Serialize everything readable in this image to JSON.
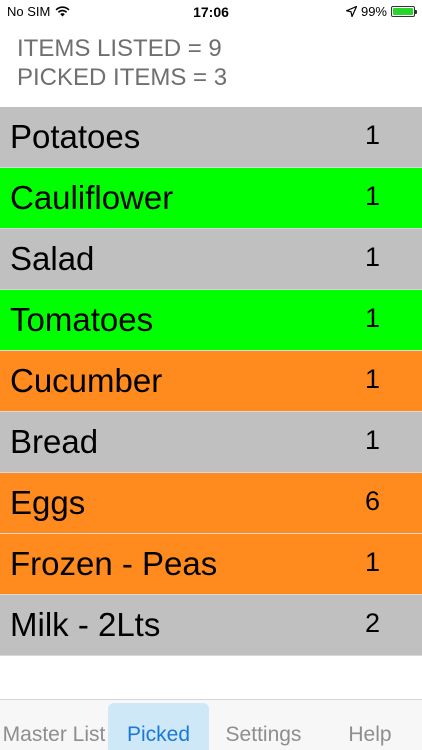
{
  "status_bar": {
    "carrier": "No SIM",
    "time": "17:06",
    "battery_percent": "99%",
    "battery_level": 0.99,
    "icons": [
      "wifi-icon",
      "location-arrow-icon",
      "battery-icon"
    ]
  },
  "summary": {
    "items_listed": "ITEMS LISTED = 9",
    "picked_items": "PICKED ITEMS = 3"
  },
  "colors": {
    "grey": "#c0c0c0",
    "green": "#00ff00",
    "orange": "#ff8a1e"
  },
  "items": [
    {
      "name": "Potatoes",
      "qty": "1",
      "color": "#c0c0c0"
    },
    {
      "name": "Cauliflower",
      "qty": "1",
      "color": "#00ff00"
    },
    {
      "name": "Salad",
      "qty": "1",
      "color": "#c0c0c0"
    },
    {
      "name": "Tomatoes",
      "qty": "1",
      "color": "#00ff00"
    },
    {
      "name": "Cucumber",
      "qty": "1",
      "color": "#ff8a1e"
    },
    {
      "name": "Bread",
      "qty": "1",
      "color": "#c0c0c0"
    },
    {
      "name": "Eggs",
      "qty": "6",
      "color": "#ff8a1e"
    },
    {
      "name": "Frozen - Peas",
      "qty": "1",
      "color": "#ff8a1e"
    },
    {
      "name": "Milk - 2Lts",
      "qty": "2",
      "color": "#c0c0c0"
    }
  ],
  "tabs": [
    {
      "label": "Master List",
      "selected": false
    },
    {
      "label": "Picked",
      "selected": true
    },
    {
      "label": "Settings",
      "selected": false
    },
    {
      "label": "Help",
      "selected": false
    }
  ]
}
